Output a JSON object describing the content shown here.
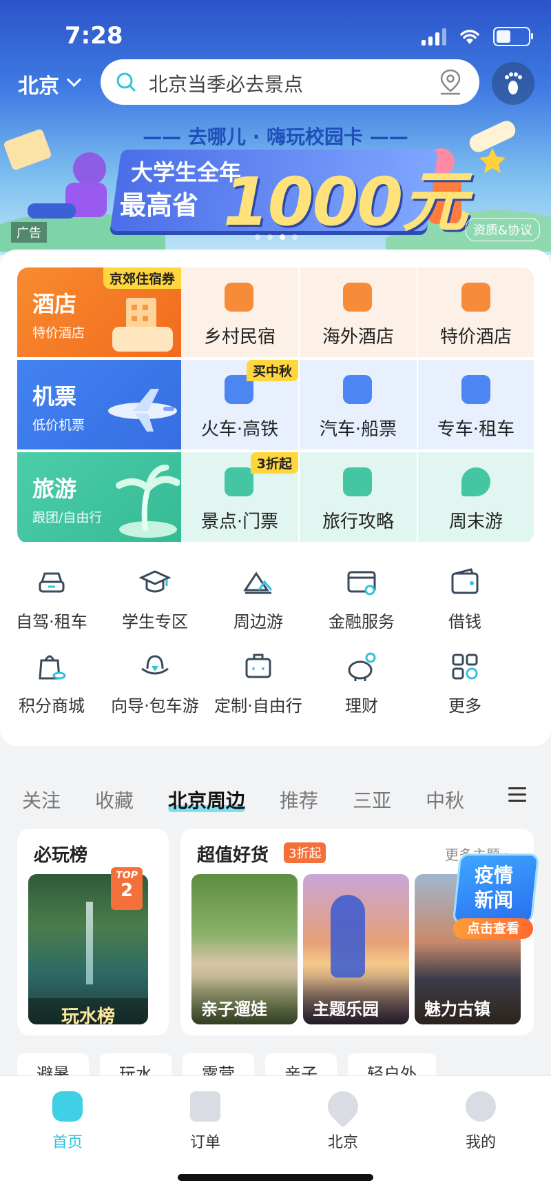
{
  "status_bar": {
    "time": "7:28"
  },
  "header": {
    "city": "北京",
    "search_placeholder": "北京当季必去景点"
  },
  "banner": {
    "title": "—— 去哪儿 · 嗨玩校园卡 ——",
    "line1": "大学生全年",
    "line2": "最高省",
    "amount": "1000元",
    "ad_label": "广告",
    "qual_label": "资质&协议"
  },
  "services": {
    "rows": [
      {
        "main": {
          "title": "酒店",
          "subtitle": "特价酒店",
          "color": "#f5832a",
          "badge": "京郊住宿券"
        },
        "items": [
          {
            "label": "乡村民宿",
            "icon": "homestay-icon"
          },
          {
            "label": "海外酒店",
            "icon": "overseas-hotel-icon"
          },
          {
            "label": "特价酒店",
            "icon": "discount-hotel-icon"
          }
        ]
      },
      {
        "main": {
          "title": "机票",
          "subtitle": "低价机票",
          "color": "#3d73e6"
        },
        "items": [
          {
            "label": "火车·高铁",
            "icon": "train-icon",
            "badge": "买中秋"
          },
          {
            "label": "汽车·船票",
            "icon": "bus-icon"
          },
          {
            "label": "专车·租车",
            "icon": "car-icon"
          }
        ]
      },
      {
        "main": {
          "title": "旅游",
          "subtitle": "跟团/自由行",
          "color": "#3ec4a0"
        },
        "items": [
          {
            "label": "景点·门票",
            "icon": "ticket-icon",
            "badge": "3折起"
          },
          {
            "label": "旅行攻略",
            "icon": "guide-book-icon"
          },
          {
            "label": "周末游",
            "icon": "map-pin-icon"
          }
        ]
      }
    ]
  },
  "quick_entries": {
    "row1": [
      {
        "label": "自驾·租车",
        "icon": "car-icon"
      },
      {
        "label": "学生专区",
        "icon": "graduation-cap-icon"
      },
      {
        "label": "周边游",
        "icon": "mountain-icon"
      },
      {
        "label": "金融服务",
        "icon": "finance-card-icon"
      },
      {
        "label": "借钱",
        "icon": "wallet-icon"
      }
    ],
    "row2": [
      {
        "label": "积分商城",
        "icon": "shopping-bag-icon"
      },
      {
        "label": "向导·包车游",
        "icon": "guide-hat-icon"
      },
      {
        "label": "定制·自由行",
        "icon": "suitcase-icon"
      },
      {
        "label": "理财",
        "icon": "piggy-bank-icon"
      },
      {
        "label": "更多",
        "icon": "grid-more-icon"
      }
    ]
  },
  "feed_tabs": [
    "关注",
    "收藏",
    "北京周边",
    "推荐",
    "三亚",
    "中秋"
  ],
  "feed_tab_active": "北京周边",
  "must_play": {
    "title": "必玩榜",
    "rank_label": "TOP",
    "rank_num": "2",
    "caption": "玩水榜"
  },
  "deals": {
    "title": "超值好货",
    "badge": "3折起",
    "more": "更多主题 ›",
    "items": [
      "亲子遛娃",
      "主题乐园",
      "魅力古镇"
    ]
  },
  "news_popup": {
    "line1": "疫情",
    "line2": "新闻",
    "button": "点击查看"
  },
  "chips": [
    "避暑",
    "玩水",
    "露营",
    "亲子",
    "轻户外"
  ],
  "tabbar": [
    {
      "label": "首页",
      "icon": "home-icon",
      "active": true
    },
    {
      "label": "订单",
      "icon": "order-icon"
    },
    {
      "label": "北京",
      "icon": "location-icon"
    },
    {
      "label": "我的",
      "icon": "profile-icon"
    }
  ],
  "colors": {
    "accent": "#2ec3dd",
    "hotel": "#f5832a",
    "flight": "#3d73e6",
    "travel": "#3ec4a0",
    "promo": "#ffd63b"
  }
}
